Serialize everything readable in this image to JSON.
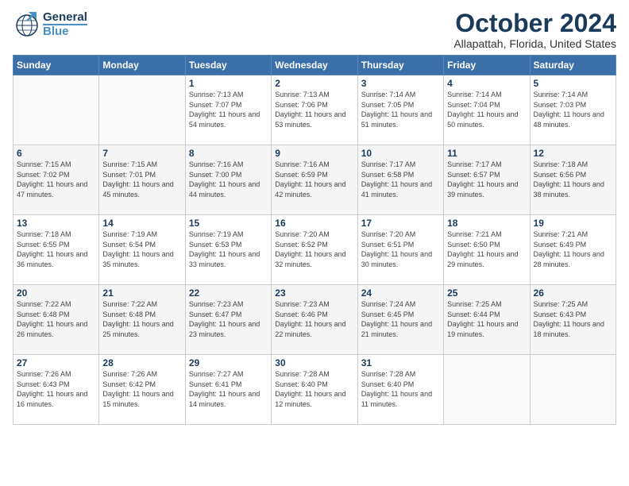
{
  "header": {
    "logo": {
      "general": "General",
      "blue": "Blue"
    },
    "title": "October 2024",
    "location": "Allapattah, Florida, United States"
  },
  "days_of_week": [
    "Sunday",
    "Monday",
    "Tuesday",
    "Wednesday",
    "Thursday",
    "Friday",
    "Saturday"
  ],
  "weeks": [
    [
      {
        "day": "",
        "info": ""
      },
      {
        "day": "",
        "info": ""
      },
      {
        "day": "1",
        "info": "Sunrise: 7:13 AM\nSunset: 7:07 PM\nDaylight: 11 hours and 54 minutes."
      },
      {
        "day": "2",
        "info": "Sunrise: 7:13 AM\nSunset: 7:06 PM\nDaylight: 11 hours and 53 minutes."
      },
      {
        "day": "3",
        "info": "Sunrise: 7:14 AM\nSunset: 7:05 PM\nDaylight: 11 hours and 51 minutes."
      },
      {
        "day": "4",
        "info": "Sunrise: 7:14 AM\nSunset: 7:04 PM\nDaylight: 11 hours and 50 minutes."
      },
      {
        "day": "5",
        "info": "Sunrise: 7:14 AM\nSunset: 7:03 PM\nDaylight: 11 hours and 48 minutes."
      }
    ],
    [
      {
        "day": "6",
        "info": "Sunrise: 7:15 AM\nSunset: 7:02 PM\nDaylight: 11 hours and 47 minutes."
      },
      {
        "day": "7",
        "info": "Sunrise: 7:15 AM\nSunset: 7:01 PM\nDaylight: 11 hours and 45 minutes."
      },
      {
        "day": "8",
        "info": "Sunrise: 7:16 AM\nSunset: 7:00 PM\nDaylight: 11 hours and 44 minutes."
      },
      {
        "day": "9",
        "info": "Sunrise: 7:16 AM\nSunset: 6:59 PM\nDaylight: 11 hours and 42 minutes."
      },
      {
        "day": "10",
        "info": "Sunrise: 7:17 AM\nSunset: 6:58 PM\nDaylight: 11 hours and 41 minutes."
      },
      {
        "day": "11",
        "info": "Sunrise: 7:17 AM\nSunset: 6:57 PM\nDaylight: 11 hours and 39 minutes."
      },
      {
        "day": "12",
        "info": "Sunrise: 7:18 AM\nSunset: 6:56 PM\nDaylight: 11 hours and 38 minutes."
      }
    ],
    [
      {
        "day": "13",
        "info": "Sunrise: 7:18 AM\nSunset: 6:55 PM\nDaylight: 11 hours and 36 minutes."
      },
      {
        "day": "14",
        "info": "Sunrise: 7:19 AM\nSunset: 6:54 PM\nDaylight: 11 hours and 35 minutes."
      },
      {
        "day": "15",
        "info": "Sunrise: 7:19 AM\nSunset: 6:53 PM\nDaylight: 11 hours and 33 minutes."
      },
      {
        "day": "16",
        "info": "Sunrise: 7:20 AM\nSunset: 6:52 PM\nDaylight: 11 hours and 32 minutes."
      },
      {
        "day": "17",
        "info": "Sunrise: 7:20 AM\nSunset: 6:51 PM\nDaylight: 11 hours and 30 minutes."
      },
      {
        "day": "18",
        "info": "Sunrise: 7:21 AM\nSunset: 6:50 PM\nDaylight: 11 hours and 29 minutes."
      },
      {
        "day": "19",
        "info": "Sunrise: 7:21 AM\nSunset: 6:49 PM\nDaylight: 11 hours and 28 minutes."
      }
    ],
    [
      {
        "day": "20",
        "info": "Sunrise: 7:22 AM\nSunset: 6:48 PM\nDaylight: 11 hours and 26 minutes."
      },
      {
        "day": "21",
        "info": "Sunrise: 7:22 AM\nSunset: 6:48 PM\nDaylight: 11 hours and 25 minutes."
      },
      {
        "day": "22",
        "info": "Sunrise: 7:23 AM\nSunset: 6:47 PM\nDaylight: 11 hours and 23 minutes."
      },
      {
        "day": "23",
        "info": "Sunrise: 7:23 AM\nSunset: 6:46 PM\nDaylight: 11 hours and 22 minutes."
      },
      {
        "day": "24",
        "info": "Sunrise: 7:24 AM\nSunset: 6:45 PM\nDaylight: 11 hours and 21 minutes."
      },
      {
        "day": "25",
        "info": "Sunrise: 7:25 AM\nSunset: 6:44 PM\nDaylight: 11 hours and 19 minutes."
      },
      {
        "day": "26",
        "info": "Sunrise: 7:25 AM\nSunset: 6:43 PM\nDaylight: 11 hours and 18 minutes."
      }
    ],
    [
      {
        "day": "27",
        "info": "Sunrise: 7:26 AM\nSunset: 6:43 PM\nDaylight: 11 hours and 16 minutes."
      },
      {
        "day": "28",
        "info": "Sunrise: 7:26 AM\nSunset: 6:42 PM\nDaylight: 11 hours and 15 minutes."
      },
      {
        "day": "29",
        "info": "Sunrise: 7:27 AM\nSunset: 6:41 PM\nDaylight: 11 hours and 14 minutes."
      },
      {
        "day": "30",
        "info": "Sunrise: 7:28 AM\nSunset: 6:40 PM\nDaylight: 11 hours and 12 minutes."
      },
      {
        "day": "31",
        "info": "Sunrise: 7:28 AM\nSunset: 6:40 PM\nDaylight: 11 hours and 11 minutes."
      },
      {
        "day": "",
        "info": ""
      },
      {
        "day": "",
        "info": ""
      }
    ]
  ]
}
